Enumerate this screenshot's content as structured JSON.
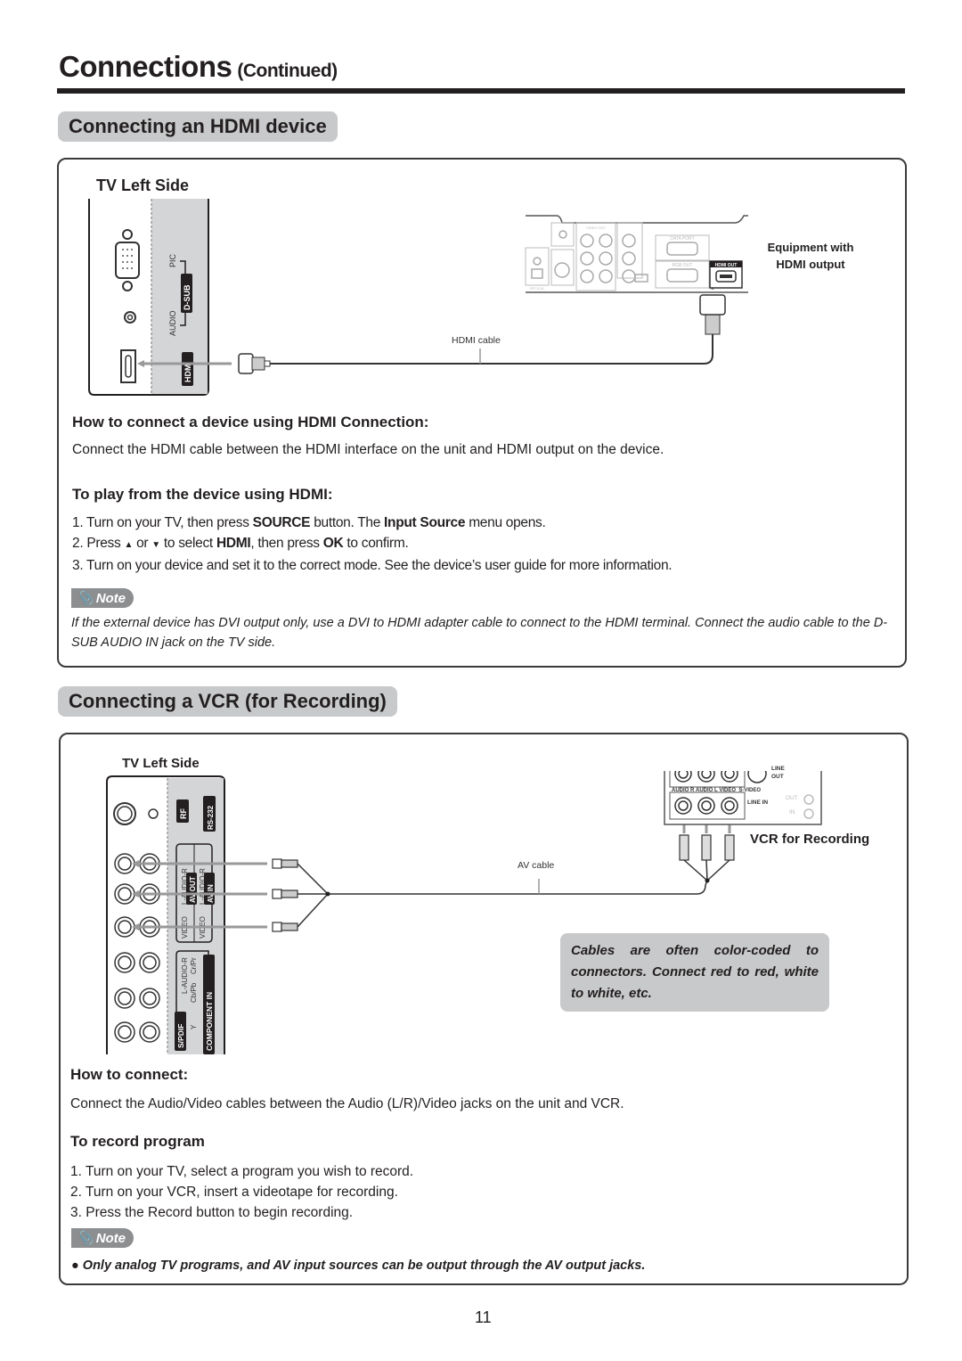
{
  "page": {
    "title": "Connections",
    "title_suffix": "(Continued)",
    "page_number": "11"
  },
  "hdmi_section": {
    "tab_label": "Connecting an HDMI device",
    "diagram": {
      "tv_side_label": "TV Left Side",
      "tv_labels": {
        "pic": "PIC",
        "audio": "AUDIO",
        "dsub": "D-SUB",
        "hdmi": "HDMI"
      },
      "cable_label": "HDMI cable",
      "equipment_label_line1": "Equipment with",
      "equipment_label_line2": "HDMI output",
      "device_labels": {
        "audio_out": "AUDIO OUT",
        "video_out": "VIDEO OUT",
        "component_out": "COMPONENT OUT",
        "digital_audio_out": "DIGITAL AUDIO OUT",
        "svideo_out": "S-VIDEO OUT",
        "optical": "OPTICAL",
        "audio_out_bottom": "AUDIO OUT",
        "data_port": "DATA PORT",
        "rgb_out": "RGB OUT",
        "hdmi_out": "HDMI OUT",
        "type": "TYPE"
      }
    },
    "how_to_heading": "How to connect a device using HDMI Connection:",
    "how_to_text": "Connect the HDMI cable between the HDMI interface on the unit and HDMI output on the device.",
    "play_heading": "To play from the device using HDMI:",
    "steps": [
      {
        "pre": "1. Turn on your TV,  then press ",
        "b1": "SOURCE",
        "mid": " button. The ",
        "b2": "Input Source",
        "post": " menu opens."
      },
      {
        "pre": "2. Press ",
        "up": "▲",
        "or": " or ",
        "down": "▼",
        "mid": " to select ",
        "b1": "HDMI",
        "mid2": ", then press ",
        "b2": "OK",
        "post": " to confirm."
      },
      {
        "text": "3. Turn on your device and set it to the correct mode. See the device’s user guide for more information."
      }
    ],
    "note_label": "Note",
    "note_text": "If the external device has DVI output only, use a DVI to HDMI adapter cable to connect to the HDMI terminal. Connect the audio cable to the D-SUB AUDIO IN jack on the TV side."
  },
  "vcr_section": {
    "tab_label": "Connecting a VCR (for Recording)",
    "diagram": {
      "tv_side_label": "TV Left Side",
      "tv_labels": {
        "rf": "RF",
        "rs232": "RS-232",
        "av_out": "AV OUT",
        "av_in": "AV IN",
        "audio_lr": "L-AUDIO-R",
        "video": "VIDEO",
        "component_in": "COMPONENT IN",
        "spdif": "S/PDIF",
        "y": "Y",
        "cb": "Cb/Pb",
        "cr": "Cr/Pr"
      },
      "cable_label": "AV cable",
      "vcr_label": "VCR for Recording",
      "vcr_labels": {
        "audio_r": "AUDIO R",
        "audio_l": "AUDIO L",
        "video": "VIDEO",
        "svideo": "S-VIDEO",
        "line_out": "LINE OUT",
        "line_in": "LINE IN",
        "out": "OUT",
        "in": "IN"
      }
    },
    "tip": "Cables are often color-coded to connectors. Connect red to red, white to white, etc.",
    "how_heading": "How to connect:",
    "how_text": "Connect the Audio/Video cables between the Audio (L/R)/Video jacks on the unit and VCR.",
    "record_heading": "To record program",
    "record_steps": [
      "1. Turn on your TV, select a program you wish to record.",
      "2. Turn on your VCR, insert a videotape for recording.",
      "3. Press the Record button to begin recording."
    ],
    "note_label": "Note",
    "note_text": "Only analog TV programs, and AV input sources can be output through the AV output jacks."
  }
}
